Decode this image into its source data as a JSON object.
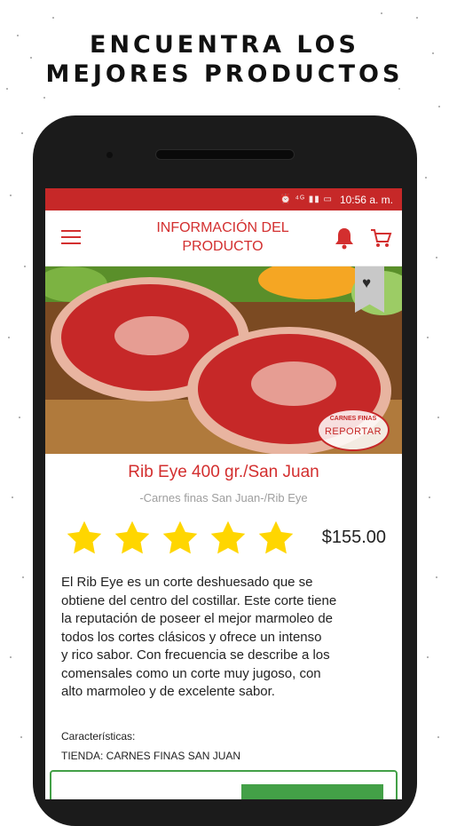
{
  "promo": {
    "line1": "ENCUENTRA LOS",
    "line2": "MEJORES PRODUCTOS"
  },
  "status_bar": {
    "time": "10:56 a. m.",
    "icons": "⏰ ⁴ᴳ ▮▮ ▭"
  },
  "app_bar": {
    "title_line1": "INFORMACIÓN DEL",
    "title_line2": "PRODUCTO",
    "menu_icon": "menu-icon",
    "bell_icon": "bell-icon",
    "cart_icon": "cart-icon"
  },
  "product": {
    "name": "Rib Eye 400 gr./San Juan",
    "category": "-Carnes finas San Juan-/Rib Eye",
    "price": "$155.00",
    "rating": 5,
    "stamp_brand": "CARNES FINAS",
    "stamp_action": "REPORTAR",
    "description": [
      "El Rib Eye es un corte deshuesado que se",
      "obtiene del centro del costillar. Este corte tiene",
      "la reputación de poseer el mejor marmoleo de",
      "todos los cortes clásicos y ofrece un intenso",
      "y rico sabor. Con frecuencia se describe a los",
      "comensales  como un corte muy jugoso, con",
      "alto marmoleo y de excelente sabor."
    ],
    "features_label": "Características:",
    "store": "TIENDA: CARNES FINAS SAN JUAN"
  },
  "colors": {
    "brand_red": "#d32f2f",
    "status_red": "#c62828",
    "star": "#ffd600",
    "green": "#43a047"
  }
}
